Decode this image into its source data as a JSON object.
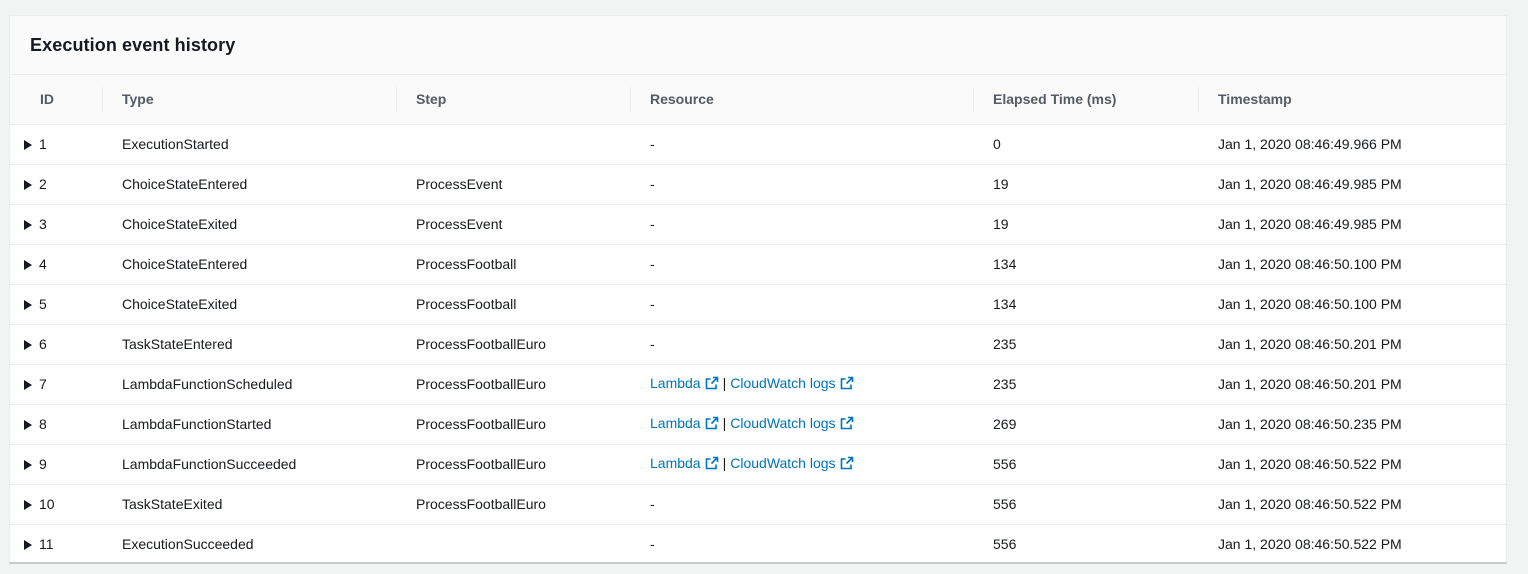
{
  "panel": {
    "title": "Execution event history"
  },
  "table": {
    "columns": [
      "ID",
      "Type",
      "Step",
      "Resource",
      "Elapsed Time (ms)",
      "Timestamp"
    ],
    "links": {
      "lambda": "Lambda",
      "separator": "|",
      "cloudwatch": "CloudWatch logs"
    },
    "rows": [
      {
        "id": "1",
        "type": "ExecutionStarted",
        "step": "",
        "resource": "-",
        "elapsed": "0",
        "timestamp": "Jan 1, 2020 08:46:49.966 PM"
      },
      {
        "id": "2",
        "type": "ChoiceStateEntered",
        "step": "ProcessEvent",
        "resource": "-",
        "elapsed": "19",
        "timestamp": "Jan 1, 2020 08:46:49.985 PM"
      },
      {
        "id": "3",
        "type": "ChoiceStateExited",
        "step": "ProcessEvent",
        "resource": "-",
        "elapsed": "19",
        "timestamp": "Jan 1, 2020 08:46:49.985 PM"
      },
      {
        "id": "4",
        "type": "ChoiceStateEntered",
        "step": "ProcessFootball",
        "resource": "-",
        "elapsed": "134",
        "timestamp": "Jan 1, 2020 08:46:50.100 PM"
      },
      {
        "id": "5",
        "type": "ChoiceStateExited",
        "step": "ProcessFootball",
        "resource": "-",
        "elapsed": "134",
        "timestamp": "Jan 1, 2020 08:46:50.100 PM"
      },
      {
        "id": "6",
        "type": "TaskStateEntered",
        "step": "ProcessFootballEuro",
        "resource": "-",
        "elapsed": "235",
        "timestamp": "Jan 1, 2020 08:46:50.201 PM"
      },
      {
        "id": "7",
        "type": "LambdaFunctionScheduled",
        "step": "ProcessFootballEuro",
        "resource": "links",
        "elapsed": "235",
        "timestamp": "Jan 1, 2020 08:46:50.201 PM"
      },
      {
        "id": "8",
        "type": "LambdaFunctionStarted",
        "step": "ProcessFootballEuro",
        "resource": "links",
        "elapsed": "269",
        "timestamp": "Jan 1, 2020 08:46:50.235 PM"
      },
      {
        "id": "9",
        "type": "LambdaFunctionSucceeded",
        "step": "ProcessFootballEuro",
        "resource": "links",
        "elapsed": "556",
        "timestamp": "Jan 1, 2020 08:46:50.522 PM"
      },
      {
        "id": "10",
        "type": "TaskStateExited",
        "step": "ProcessFootballEuro",
        "resource": "-",
        "elapsed": "556",
        "timestamp": "Jan 1, 2020 08:46:50.522 PM"
      },
      {
        "id": "11",
        "type": "ExecutionSucceeded",
        "step": "",
        "resource": "-",
        "elapsed": "556",
        "timestamp": "Jan 1, 2020 08:46:50.522 PM"
      }
    ]
  }
}
